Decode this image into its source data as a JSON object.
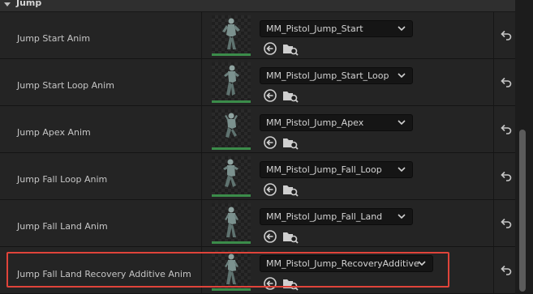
{
  "section": {
    "title": "Jump",
    "icon": "collapse-arrow-icon"
  },
  "properties": [
    {
      "label": "Jump Start Anim",
      "value": "MM_Pistol_Jump_Start"
    },
    {
      "label": "Jump Start Loop Anim",
      "value": "MM_Pistol_Jump_Start_Loop"
    },
    {
      "label": "Jump Apex Anim",
      "value": "MM_Pistol_Jump_Apex"
    },
    {
      "label": "Jump Fall Loop Anim",
      "value": "MM_Pistol_Jump_Fall_Loop"
    },
    {
      "label": "Jump Fall Land Anim",
      "value": "MM_Pistol_Jump_Fall_Land"
    },
    {
      "label": "Jump Fall Land Recovery Additive Anim",
      "value": "MM_Pistol_Jump_RecoveryAdditive"
    }
  ],
  "icons": {
    "dropdown": "chevron-down-icon",
    "use_selected": "use-selected-arrow-icon",
    "browse": "browse-folder-icon",
    "reset": "reset-to-default-icon",
    "thumbnail": "animation-thumbnail"
  },
  "colors": {
    "highlight": "#e0443a",
    "thumbnail_bar": "#3b8c4a",
    "panel_bg": "#242424"
  }
}
